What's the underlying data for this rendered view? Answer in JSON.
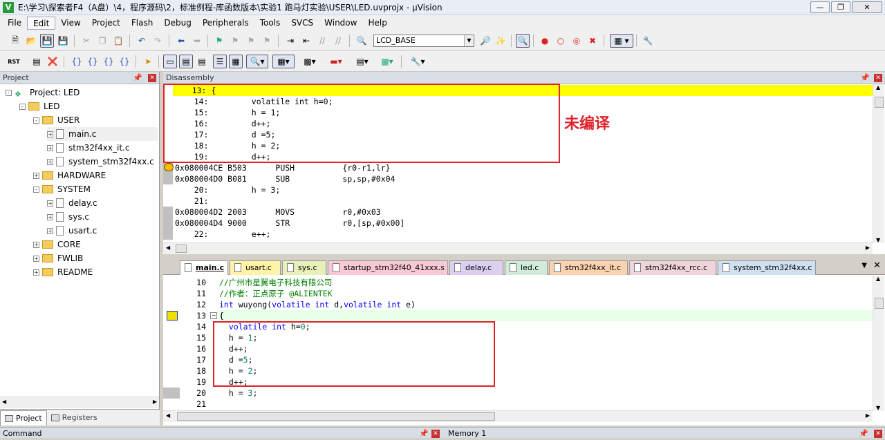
{
  "window": {
    "title": "E:\\学习\\探索者F4（A盘）\\4，程序源码\\2，标准例程-库函数版本\\实验1 跑马灯实验\\USER\\LED.uvprojx - µVision"
  },
  "menu": [
    "File",
    "Edit",
    "View",
    "Project",
    "Flash",
    "Debug",
    "Peripherals",
    "Tools",
    "SVCS",
    "Window",
    "Help"
  ],
  "toolbar": {
    "target_combo": "LCD_BASE",
    "reset_label": "RST"
  },
  "project_panel": {
    "title": "Project",
    "root": "Project: LED",
    "tree": [
      {
        "label": "LED",
        "level": 1,
        "type": "target",
        "exp": "-"
      },
      {
        "label": "USER",
        "level": 2,
        "type": "folder",
        "exp": "-"
      },
      {
        "label": "main.c",
        "level": 3,
        "type": "file",
        "exp": "+",
        "selected": true
      },
      {
        "label": "stm32f4xx_it.c",
        "level": 3,
        "type": "file",
        "exp": "+"
      },
      {
        "label": "system_stm32f4xx.c",
        "level": 3,
        "type": "file",
        "exp": "+"
      },
      {
        "label": "HARDWARE",
        "level": 2,
        "type": "folder",
        "exp": "+"
      },
      {
        "label": "SYSTEM",
        "level": 2,
        "type": "folder",
        "exp": "-"
      },
      {
        "label": "delay.c",
        "level": 3,
        "type": "file",
        "exp": "+"
      },
      {
        "label": "sys.c",
        "level": 3,
        "type": "file",
        "exp": "+"
      },
      {
        "label": "usart.c",
        "level": 3,
        "type": "file",
        "exp": "+"
      },
      {
        "label": "CORE",
        "level": 2,
        "type": "folder",
        "exp": "+"
      },
      {
        "label": "FWLIB",
        "level": 2,
        "type": "folder",
        "exp": "+"
      },
      {
        "label": "README",
        "level": 2,
        "type": "folder",
        "exp": "+"
      }
    ],
    "tabs": [
      "Project",
      "Registers"
    ]
  },
  "disassembly": {
    "title": "Disassembly",
    "annotation": "未编译",
    "lines": [
      "    13: {",
      "    14:         volatile int h=0;",
      "    15:         h = 1;",
      "    16:         d++;",
      "    17:         d =5;",
      "    18:         h = 2;",
      "    19:         d++;",
      "0x080004CE B503      PUSH          {r0-r1,lr}",
      "0x080004D0 B081      SUB           sp,sp,#0x04",
      "    20:         h = 3;",
      "    21:",
      "0x080004D2 2003      MOVS          r0,#0x03",
      "0x080004D4 9000      STR           r0,[sp,#0x00]",
      "    22:         e++;"
    ]
  },
  "editor": {
    "tabs": [
      {
        "label": "main.c",
        "color": "#ffffff"
      },
      {
        "label": "usart.c",
        "color": "#fff3a8"
      },
      {
        "label": "sys.c",
        "color": "#e6f0b8"
      },
      {
        "label": "startup_stm32f40_41xxx.s",
        "color": "#f7c9d6"
      },
      {
        "label": "delay.c",
        "color": "#dccff0"
      },
      {
        "label": "led.c",
        "color": "#d0ecd8"
      },
      {
        "label": "stm32f4xx_it.c",
        "color": "#fbd2b0"
      },
      {
        "label": "stm32f4xx_rcc.c",
        "color": "#f0d4dc"
      },
      {
        "label": "system_stm32f4xx.c",
        "color": "#cfe0f0"
      }
    ],
    "lines": [
      {
        "n": "10",
        "t": "//广州市星翼电子科技有限公司"
      },
      {
        "n": "11",
        "t": "//作者：正点原子 @ALIENTEK"
      },
      {
        "n": "12",
        "t": "int wuyong(volatile int d,volatile int e)"
      },
      {
        "n": "13",
        "t": "{"
      },
      {
        "n": "14",
        "t": "  volatile int h=0;"
      },
      {
        "n": "15",
        "t": "  h = 1;"
      },
      {
        "n": "16",
        "t": "  d++;"
      },
      {
        "n": "17",
        "t": "  d =5;"
      },
      {
        "n": "18",
        "t": "  h = 2;"
      },
      {
        "n": "19",
        "t": "  d++;"
      },
      {
        "n": "20",
        "t": "  h = 3;"
      },
      {
        "n": "21",
        "t": ""
      }
    ]
  },
  "bottom": {
    "left": "Command",
    "right": "Memory 1"
  },
  "colors": {
    "exec_highlight": "#ffff00",
    "current_line": "#e8ffe8",
    "annotation": "#e0202a"
  }
}
